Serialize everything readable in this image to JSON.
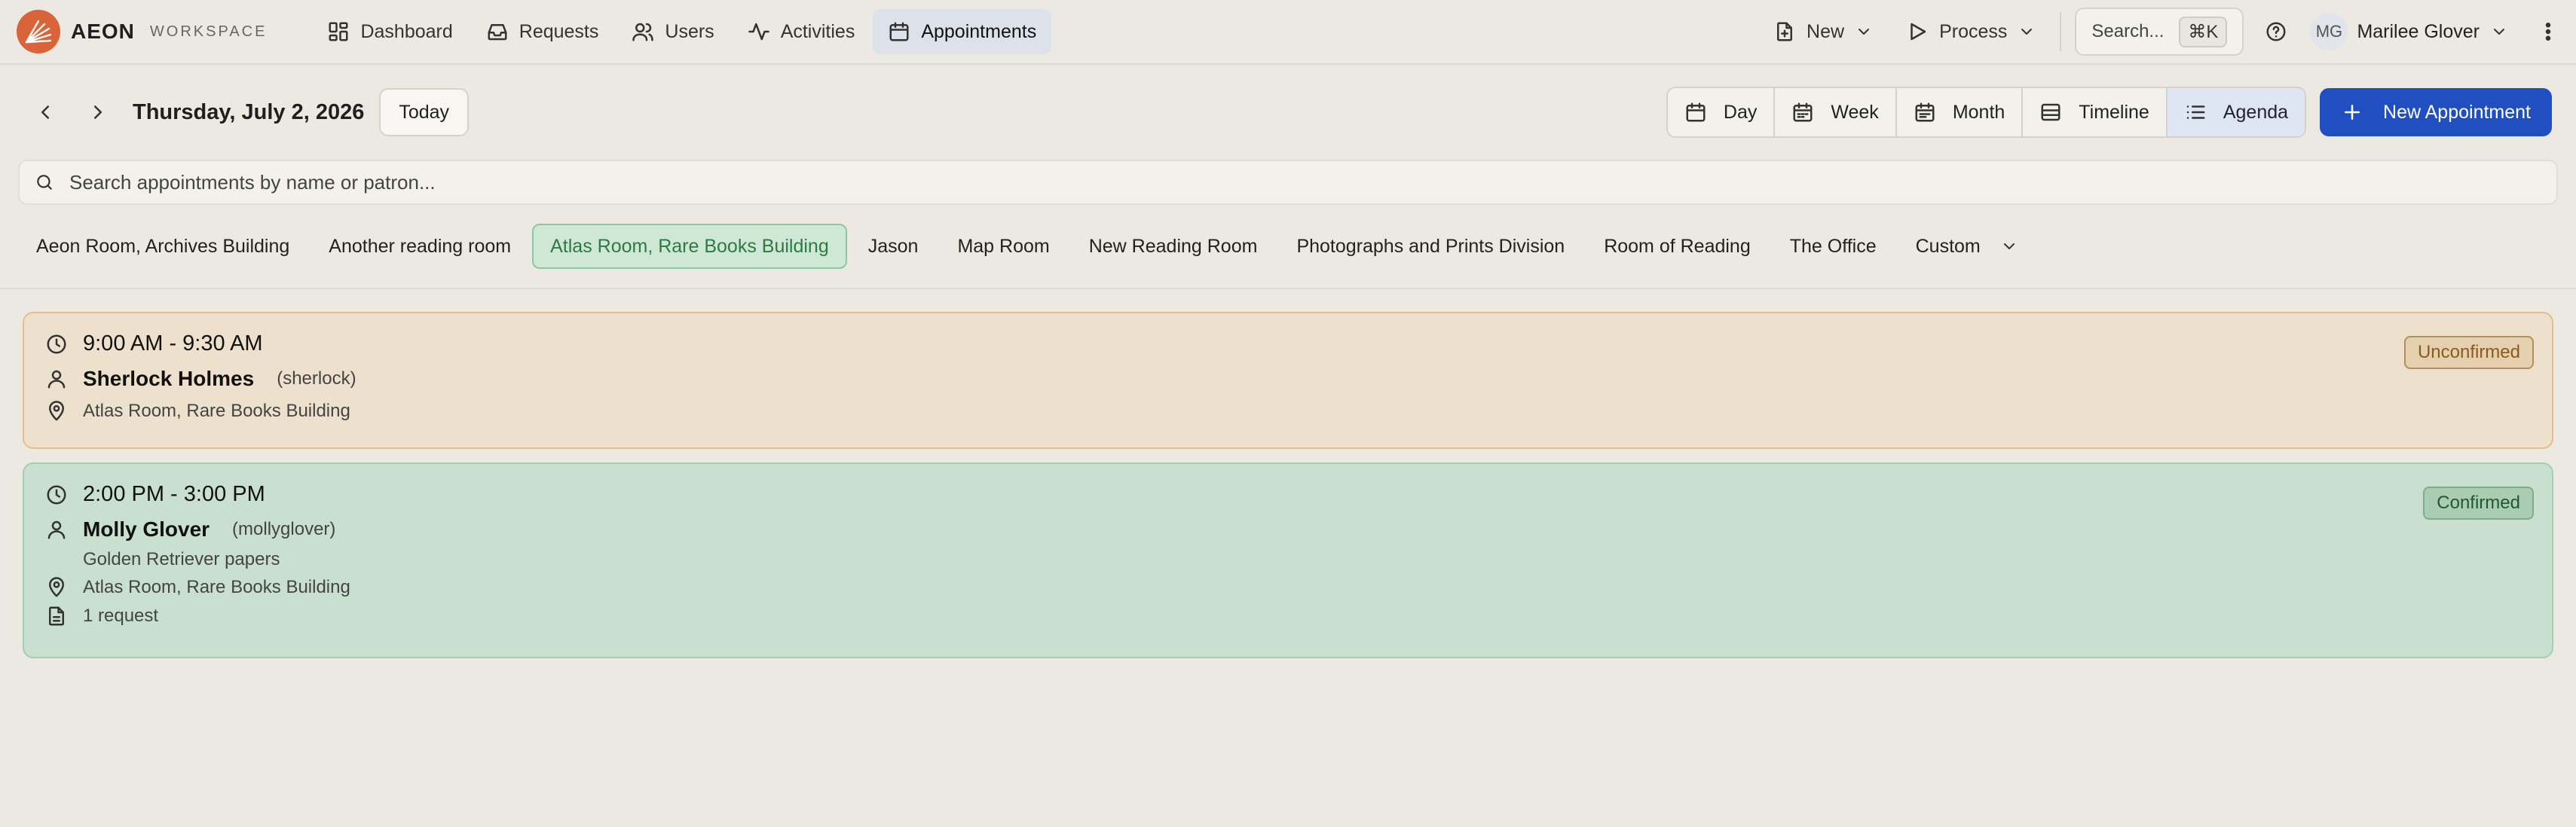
{
  "brand": {
    "name": "AEON",
    "sub": "WORKSPACE"
  },
  "nav": [
    {
      "label": "Dashboard",
      "icon": "dashboard-icon"
    },
    {
      "label": "Requests",
      "icon": "inbox-icon"
    },
    {
      "label": "Users",
      "icon": "users-icon"
    },
    {
      "label": "Activities",
      "icon": "activity-icon"
    },
    {
      "label": "Appointments",
      "icon": "calendar-icon",
      "active": true
    }
  ],
  "top_actions": {
    "new_label": "New",
    "process_label": "Process"
  },
  "search": {
    "label": "Search...",
    "shortcut": "⌘K"
  },
  "user": {
    "initials": "MG",
    "name": "Marilee Glover"
  },
  "toolbar": {
    "date": "Thursday, July 2, 2026",
    "today_label": "Today",
    "views": [
      "Day",
      "Week",
      "Month",
      "Timeline",
      "Agenda"
    ],
    "active_view": "Agenda",
    "new_appointment_label": "New Appointment"
  },
  "appt_search": {
    "placeholder": "Search appointments by name or patron..."
  },
  "rooms": [
    "Aeon Room, Archives Building",
    "Another reading room",
    "Atlas Room, Rare Books Building",
    "Jason",
    "Map Room",
    "New Reading Room",
    "Photographs and Prints Division",
    "Room of Reading",
    "The Office",
    "Custom"
  ],
  "active_room": "Atlas Room, Rare Books Building",
  "appointments": [
    {
      "time": "9:00 AM - 9:30 AM",
      "patron": "Sherlock Holmes",
      "username": "(sherlock)",
      "location": "Atlas Room, Rare Books Building",
      "status": "Unconfirmed"
    },
    {
      "time": "2:00 PM - 3:00 PM",
      "patron": "Molly Glover",
      "username": "(mollyglover)",
      "note": "Golden Retriever papers",
      "location": "Atlas Room, Rare Books Building",
      "requests": "1 request",
      "status": "Confirmed"
    }
  ],
  "colors": {
    "accent": "#1f4fc1",
    "unconfirmed_bg": "#ede1cd",
    "confirmed_bg": "#c9dfd0",
    "active_room": "#cfe7d5"
  }
}
